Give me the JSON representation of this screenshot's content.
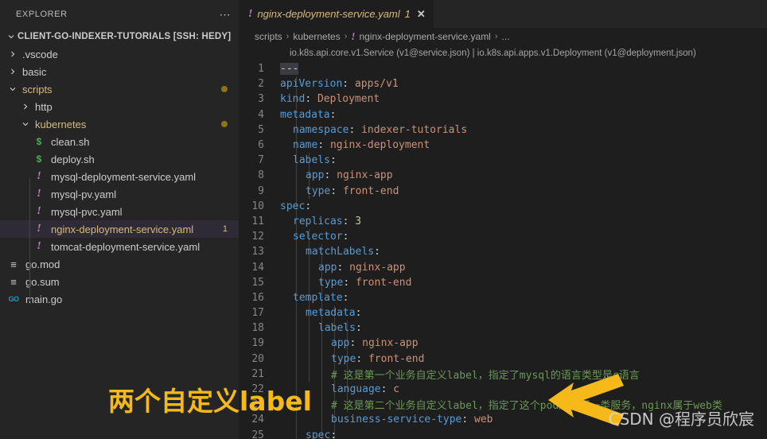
{
  "sidebar": {
    "header_title": "EXPLORER",
    "more_icon": "ellipsis-icon",
    "root_label": "CLIENT-GO-INDEXER-TUTORIALS [SSH: HEDY]",
    "items": [
      {
        "label": ".vscode",
        "type": "folder",
        "state": "collapsed",
        "depth": 1,
        "icon": "chevron-right-icon",
        "badge": ""
      },
      {
        "label": "basic",
        "type": "folder",
        "state": "collapsed",
        "depth": 1,
        "icon": "chevron-right-icon",
        "badge": ""
      },
      {
        "label": "scripts",
        "type": "folder",
        "state": "expanded",
        "depth": 1,
        "icon": "chevron-down-icon",
        "badge": "dot"
      },
      {
        "label": "http",
        "type": "folder",
        "state": "collapsed",
        "depth": 2,
        "icon": "chevron-right-icon",
        "badge": ""
      },
      {
        "label": "kubernetes",
        "type": "folder",
        "state": "expanded",
        "depth": 2,
        "icon": "chevron-down-icon",
        "badge": "dot"
      },
      {
        "label": "clean.sh",
        "type": "file",
        "kind": "sh",
        "depth": 3,
        "badge": ""
      },
      {
        "label": "deploy.sh",
        "type": "file",
        "kind": "sh",
        "depth": 3,
        "badge": ""
      },
      {
        "label": "mysql-deployment-service.yaml",
        "type": "file",
        "kind": "yaml",
        "depth": 3,
        "badge": ""
      },
      {
        "label": "mysql-pv.yaml",
        "type": "file",
        "kind": "yaml",
        "depth": 3,
        "badge": ""
      },
      {
        "label": "mysql-pvc.yaml",
        "type": "file",
        "kind": "yaml",
        "depth": 3,
        "badge": ""
      },
      {
        "label": "nginx-deployment-service.yaml",
        "type": "file",
        "kind": "yaml",
        "depth": 3,
        "badge": "1",
        "selected": true
      },
      {
        "label": "tomcat-deployment-service.yaml",
        "type": "file",
        "kind": "yaml",
        "depth": 3,
        "badge": ""
      },
      {
        "label": "go.mod",
        "type": "file",
        "kind": "mod",
        "depth": 1,
        "badge": ""
      },
      {
        "label": "go.sum",
        "type": "file",
        "kind": "mod",
        "depth": 1,
        "badge": ""
      },
      {
        "label": "main.go",
        "type": "file",
        "kind": "go",
        "depth": 1,
        "badge": ""
      }
    ]
  },
  "editor": {
    "tab": {
      "icon": "yaml-warning-icon",
      "label": "nginx-deployment-service.yaml",
      "problem_count": "1",
      "close_label": "✕"
    },
    "breadcrumb": {
      "parts": [
        "scripts",
        "kubernetes",
        "nginx-deployment-service.yaml",
        "..."
      ],
      "separator": "›",
      "file_icon": "yaml-warning-icon"
    },
    "schema_info": "io.k8s.api.core.v1.Service (v1@service.json) | io.k8s.api.apps.v1.Deployment (v1@deployment.json)",
    "lines": [
      {
        "no": "1",
        "indent": 0,
        "tokens": [
          {
            "t": "---",
            "c": "dash"
          }
        ]
      },
      {
        "no": "2",
        "indent": 0,
        "tokens": [
          {
            "t": "apiVersion",
            "c": "k"
          },
          {
            "t": ": ",
            "c": "c"
          },
          {
            "t": "apps/v1",
            "c": "s"
          }
        ]
      },
      {
        "no": "3",
        "indent": 0,
        "tokens": [
          {
            "t": "kind",
            "c": "k"
          },
          {
            "t": ": ",
            "c": "c"
          },
          {
            "t": "Deployment",
            "c": "s"
          }
        ]
      },
      {
        "no": "4",
        "indent": 0,
        "tokens": [
          {
            "t": "metadata",
            "c": "k"
          },
          {
            "t": ":",
            "c": "c"
          }
        ]
      },
      {
        "no": "5",
        "indent": 1,
        "tokens": [
          {
            "t": "namespace",
            "c": "k"
          },
          {
            "t": ": ",
            "c": "c"
          },
          {
            "t": "indexer-tutorials",
            "c": "s"
          }
        ]
      },
      {
        "no": "6",
        "indent": 1,
        "tokens": [
          {
            "t": "name",
            "c": "k"
          },
          {
            "t": ": ",
            "c": "c"
          },
          {
            "t": "nginx-deployment",
            "c": "s"
          }
        ]
      },
      {
        "no": "7",
        "indent": 1,
        "tokens": [
          {
            "t": "labels",
            "c": "k"
          },
          {
            "t": ":",
            "c": "c"
          }
        ]
      },
      {
        "no": "8",
        "indent": 2,
        "tokens": [
          {
            "t": "app",
            "c": "k"
          },
          {
            "t": ": ",
            "c": "c"
          },
          {
            "t": "nginx-app",
            "c": "s"
          }
        ]
      },
      {
        "no": "9",
        "indent": 2,
        "tokens": [
          {
            "t": "type",
            "c": "k"
          },
          {
            "t": ": ",
            "c": "c"
          },
          {
            "t": "front-end",
            "c": "s"
          }
        ]
      },
      {
        "no": "10",
        "indent": 0,
        "tokens": [
          {
            "t": "spec",
            "c": "k"
          },
          {
            "t": ":",
            "c": "c"
          }
        ]
      },
      {
        "no": "11",
        "indent": 1,
        "tokens": [
          {
            "t": "replicas",
            "c": "k"
          },
          {
            "t": ": ",
            "c": "c"
          },
          {
            "t": "3",
            "c": "n"
          }
        ]
      },
      {
        "no": "12",
        "indent": 1,
        "tokens": [
          {
            "t": "selector",
            "c": "k"
          },
          {
            "t": ":",
            "c": "c"
          }
        ]
      },
      {
        "no": "13",
        "indent": 2,
        "tokens": [
          {
            "t": "matchLabels",
            "c": "k"
          },
          {
            "t": ":",
            "c": "c"
          }
        ]
      },
      {
        "no": "14",
        "indent": 3,
        "tokens": [
          {
            "t": "app",
            "c": "k"
          },
          {
            "t": ": ",
            "c": "c"
          },
          {
            "t": "nginx-app",
            "c": "s"
          }
        ]
      },
      {
        "no": "15",
        "indent": 3,
        "tokens": [
          {
            "t": "type",
            "c": "k"
          },
          {
            "t": ": ",
            "c": "c"
          },
          {
            "t": "front-end",
            "c": "s"
          }
        ]
      },
      {
        "no": "16",
        "indent": 1,
        "tokens": [
          {
            "t": "template",
            "c": "k"
          },
          {
            "t": ":",
            "c": "c"
          }
        ]
      },
      {
        "no": "17",
        "indent": 2,
        "tokens": [
          {
            "t": "metadata",
            "c": "k"
          },
          {
            "t": ":",
            "c": "c"
          }
        ]
      },
      {
        "no": "18",
        "indent": 3,
        "tokens": [
          {
            "t": "labels",
            "c": "k"
          },
          {
            "t": ":",
            "c": "c"
          }
        ]
      },
      {
        "no": "19",
        "indent": 4,
        "tokens": [
          {
            "t": "app",
            "c": "k"
          },
          {
            "t": ": ",
            "c": "c"
          },
          {
            "t": "nginx-app",
            "c": "s"
          }
        ]
      },
      {
        "no": "20",
        "indent": 4,
        "tokens": [
          {
            "t": "type",
            "c": "k"
          },
          {
            "t": ": ",
            "c": "c"
          },
          {
            "t": "front-end",
            "c": "s"
          }
        ]
      },
      {
        "no": "21",
        "indent": 4,
        "tokens": [
          {
            "t": "# 这是第一个业务自定义label，指定了mysql的语言类型是c语言",
            "c": "cm"
          }
        ]
      },
      {
        "no": "22",
        "indent": 4,
        "tokens": [
          {
            "t": "language",
            "c": "k"
          },
          {
            "t": ": ",
            "c": "c"
          },
          {
            "t": "c",
            "c": "s"
          }
        ]
      },
      {
        "no": "23",
        "indent": 4,
        "tokens": [
          {
            "t": "# 这是第二个业务自定义label，指定了这个pod属于哪一类服务，nginx属于web类",
            "c": "cm"
          }
        ]
      },
      {
        "no": "24",
        "indent": 4,
        "tokens": [
          {
            "t": "business-service-type",
            "c": "k"
          },
          {
            "t": ": ",
            "c": "c"
          },
          {
            "t": "web",
            "c": "s"
          }
        ]
      },
      {
        "no": "25",
        "indent": 2,
        "tokens": [
          {
            "t": "spec",
            "c": "k"
          },
          {
            "t": ":",
            "c": "c"
          }
        ]
      }
    ]
  },
  "annotation": {
    "text": "两个自定义label",
    "color": "#f5b919",
    "arrow_icon": "double-arrow-right-icon"
  },
  "watermark": {
    "text": "CSDN @程序员欣宸"
  },
  "colors": {
    "sidebar_bg": "#252526",
    "editor_bg": "#1e1e1e",
    "accent_yellow": "#d7ba7d",
    "annotation": "#f5b919",
    "key_blue": "#569cd6",
    "string_orange": "#ce9178",
    "comment_green": "#6a9955",
    "yaml_icon_purple": "#c586c0"
  }
}
